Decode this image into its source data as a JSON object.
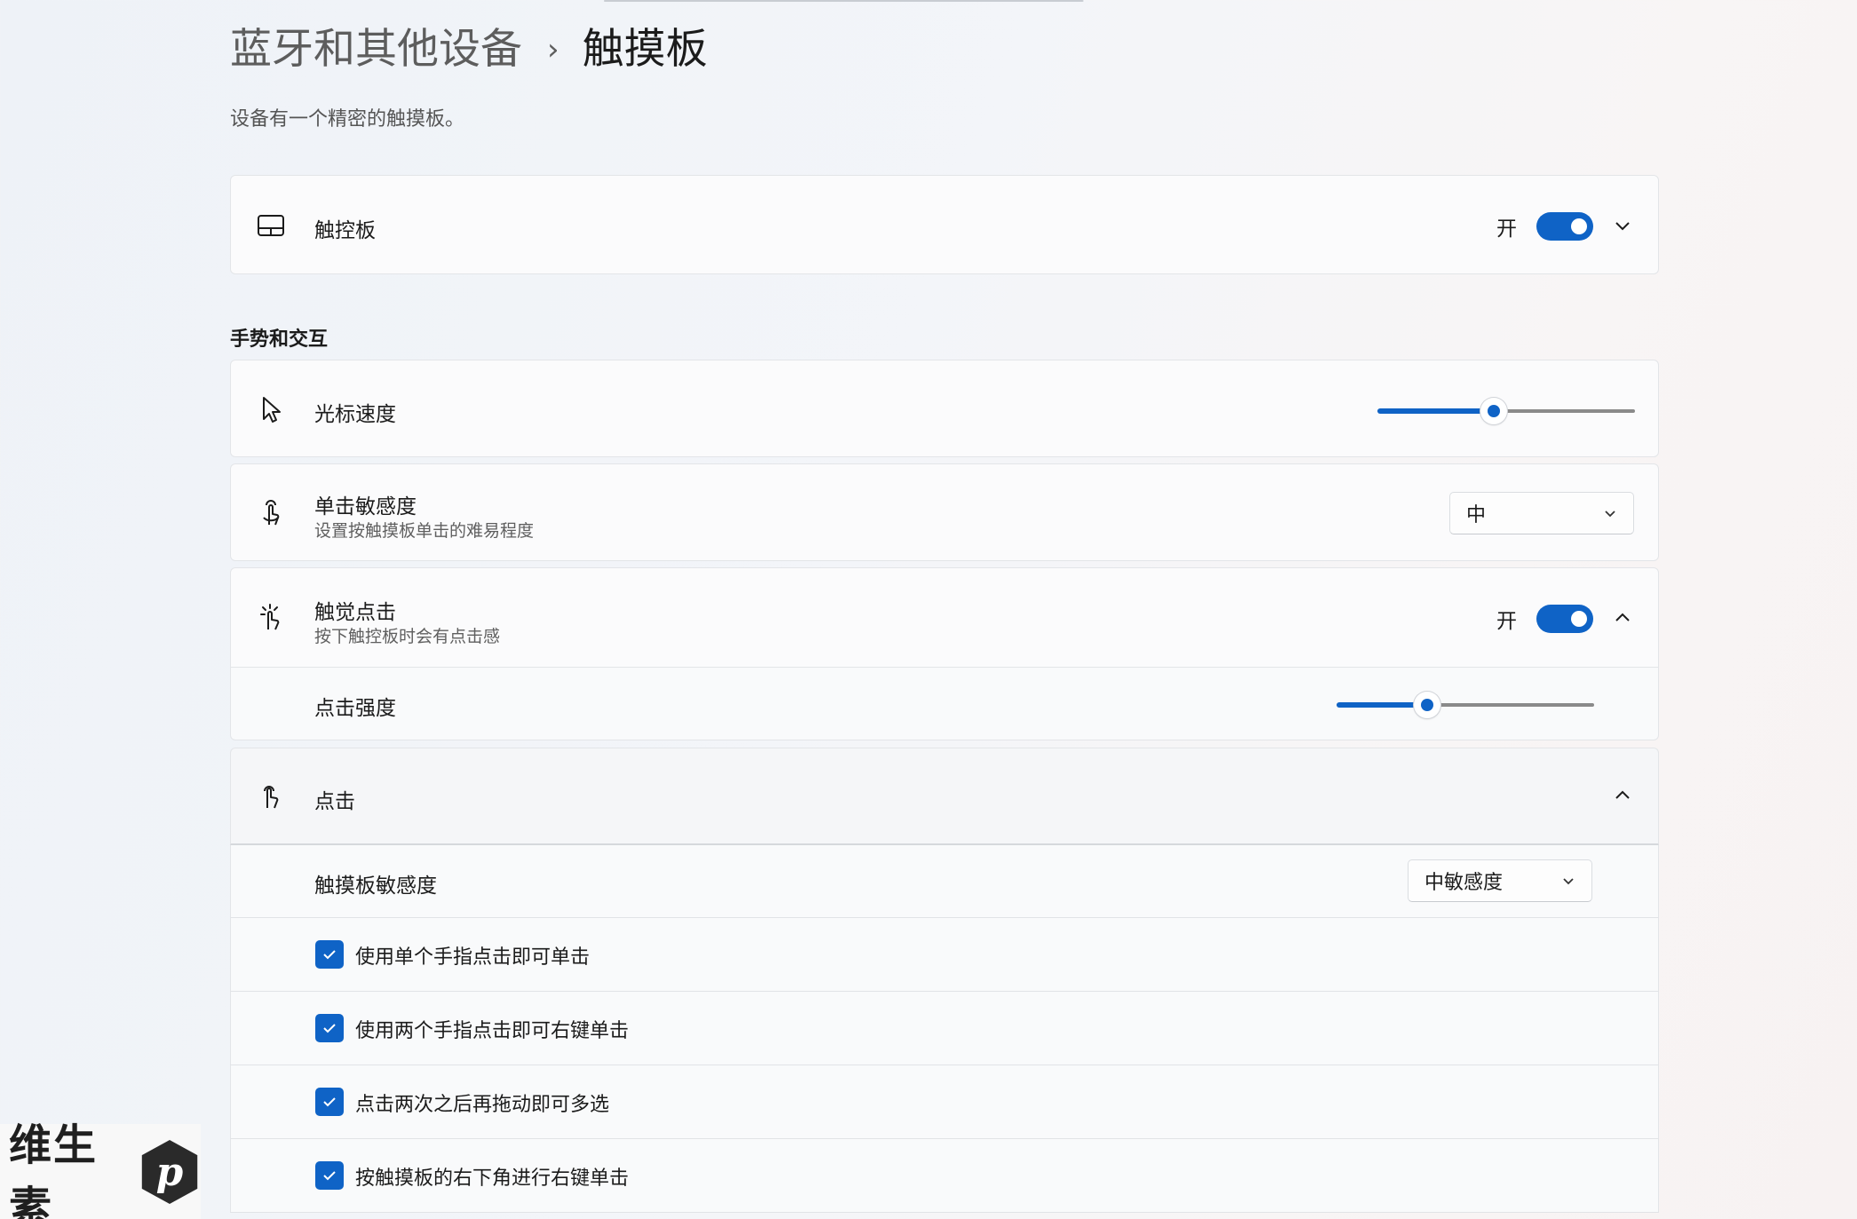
{
  "breadcrumb": {
    "parent": "蓝牙和其他设备",
    "separator": "›",
    "current": "触摸板"
  },
  "subtitle": "设备有一个精密的触摸板。",
  "touchpad": {
    "title": "触控板",
    "toggle_label": "开",
    "toggle_on": true
  },
  "section_gestures": "手势和交互",
  "cursor_speed": {
    "title": "光标速度",
    "value_fraction": 0.45
  },
  "tap_sensitivity": {
    "title": "单击敏感度",
    "description": "设置按触摸板单击的难易程度",
    "selected": "中"
  },
  "haptic": {
    "title": "触觉点击",
    "description": "按下触控板时会有点击感",
    "toggle_label": "开",
    "toggle_on": true,
    "intensity": {
      "title": "点击强度",
      "value_fraction": 0.35
    }
  },
  "taps": {
    "title": "点击",
    "sensitivity": {
      "label": "触摸板敏感度",
      "selected": "中敏感度"
    },
    "checkboxes": [
      {
        "label": "使用单个手指点击即可单击",
        "checked": true
      },
      {
        "label": "使用两个手指点击即可右键单击",
        "checked": true
      },
      {
        "label": "点击两次之后再拖动即可多选",
        "checked": true
      },
      {
        "label": "按触摸板的右下角进行右键单击",
        "checked": true
      }
    ]
  },
  "watermark": {
    "text": "维生素",
    "logo_letter": "p"
  },
  "colors": {
    "accent": "#0f63c6",
    "background": "#f3f5f9",
    "card": "#fbfbfc"
  },
  "icons": [
    "touchpad-icon",
    "cursor-icon",
    "tap-icon",
    "haptic-icon",
    "click-icon",
    "chevron-down-icon",
    "chevron-up-icon",
    "checkmark-icon"
  ]
}
